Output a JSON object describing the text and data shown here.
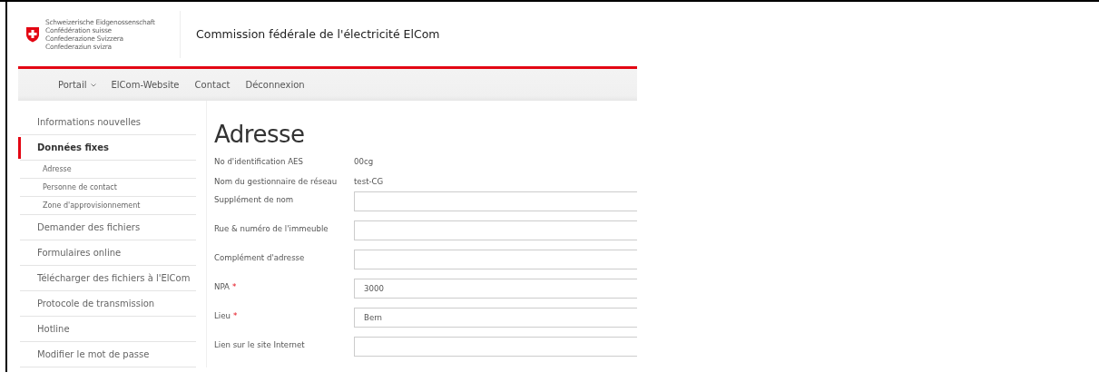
{
  "header": {
    "confederation_names": [
      "Schweizerische Eidgenossenschaft",
      "Confédération suisse",
      "Confederazione Svizzera",
      "Confederaziun svizra"
    ],
    "title": "Commission fédérale de l'électricité ElCom"
  },
  "nav": [
    {
      "label": "Portail",
      "kind": "dropdown"
    },
    {
      "label": "ElCom-Website",
      "kind": "link"
    },
    {
      "label": "Contact",
      "kind": "link"
    },
    {
      "label": "Déconnexion",
      "kind": "link"
    }
  ],
  "sidebar": {
    "items": [
      {
        "label": "Informations nouvelles",
        "selected": false
      },
      {
        "label": "Données fixes",
        "selected": true,
        "children": [
          {
            "label": "Adresse",
            "selected": false
          },
          {
            "label": "Personne de contact",
            "selected": false
          },
          {
            "label": "Zone d'approvisionnement",
            "selected": false
          }
        ]
      },
      {
        "label": "Demander des fichiers",
        "selected": false
      },
      {
        "label": "Formulaires online",
        "selected": false
      },
      {
        "label": "Télécharger des fichiers à l'ElCom",
        "selected": false
      },
      {
        "label": "Protocole de transmission",
        "selected": false
      },
      {
        "label": "Hotline",
        "selected": false
      },
      {
        "label": "Modifier le mot de passe",
        "selected": false
      }
    ]
  },
  "page_title": "Adresse",
  "form": [
    {
      "kind": "static",
      "label": "No d'identification AES",
      "value": "00cg"
    },
    {
      "kind": "static",
      "label": "Nom du gestionnaire de réseau",
      "value": "test-CG"
    },
    {
      "kind": "input",
      "label": "Supplément de nom"
    },
    {
      "kind": "input",
      "label": "Rue & numéro de l'immeuble"
    },
    {
      "kind": "input",
      "label": "Complément d'adresse"
    },
    {
      "kind": "input",
      "label": "NPA",
      "required_mark": "*",
      "value": "3000"
    },
    {
      "kind": "input",
      "label": "Lieu",
      "required_mark": "*",
      "value": "Bern"
    },
    {
      "kind": "input",
      "label": "Lien sur le site Internet"
    }
  ]
}
